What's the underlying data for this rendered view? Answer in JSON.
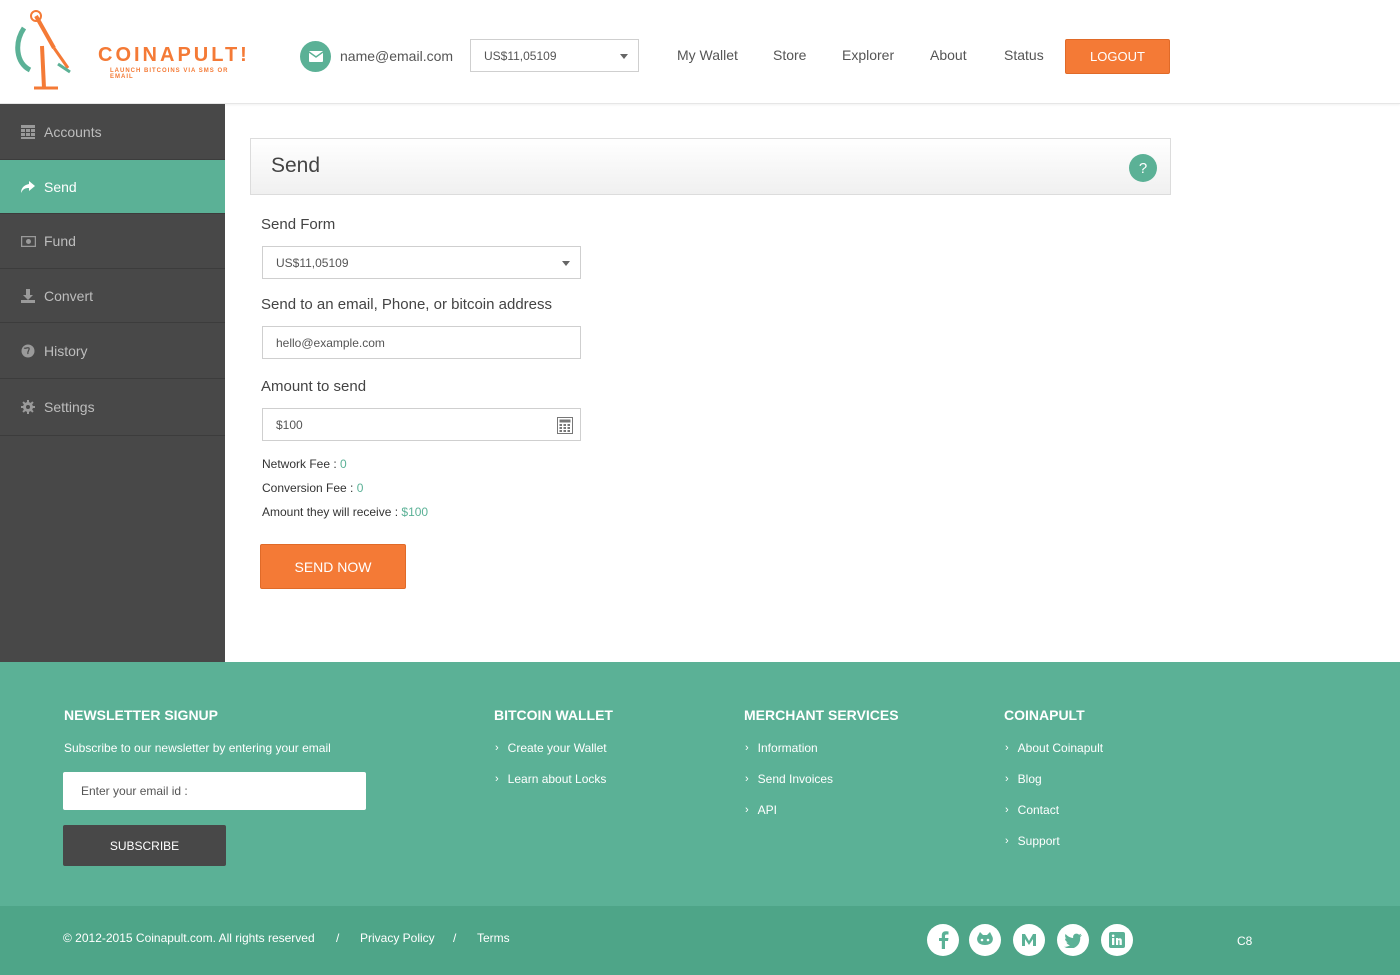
{
  "brand": {
    "name": "COINAPULT!",
    "tagline": "LAUNCH BITCOINS VIA SMS OR EMAIL",
    "orange": "#f47a36",
    "green": "#5bb196"
  },
  "header": {
    "email": "name@email.com",
    "balance_select": "US$11,05109",
    "nav": [
      "My Wallet",
      "Store",
      "Explorer",
      "About",
      "Status"
    ],
    "logout_label": "LOGOUT"
  },
  "sidebar": {
    "items": [
      {
        "label": "Accounts",
        "icon": "grid-icon"
      },
      {
        "label": "Send",
        "icon": "share-icon"
      },
      {
        "label": "Fund",
        "icon": "money-icon"
      },
      {
        "label": "Convert",
        "icon": "download-icon"
      },
      {
        "label": "History",
        "icon": "globe-icon"
      },
      {
        "label": "Settings",
        "icon": "gear-icon"
      }
    ],
    "active": "Send"
  },
  "main": {
    "title": "Send",
    "help_label": "?",
    "send_form_label": "Send Form",
    "send_form_value": "US$11,05109",
    "recipient_label": "Send to an email, Phone, or bitcoin address",
    "recipient_placeholder": "hello@example.com",
    "amount_label": "Amount to send",
    "amount_value": "$100",
    "network_fee_label": "Network Fee :",
    "network_fee_value": "0",
    "conversion_fee_label": "Conversion Fee :",
    "conversion_fee_value": "0",
    "receive_label": "Amount they will receive :",
    "receive_value": "$100",
    "send_button": "SEND NOW"
  },
  "footer": {
    "newsletter": {
      "title": "NEWSLETTER SIGNUP",
      "subtitle": "Subscribe to our newsletter by entering your email",
      "placeholder": "Enter your email id :",
      "button": "SUBSCRIBE"
    },
    "bitcoin_wallet": {
      "title": "BITCOIN WALLET",
      "links": [
        "Create your Wallet",
        "Learn about Locks"
      ]
    },
    "merchant_services": {
      "title": "MERCHANT SERVICES",
      "links": [
        "Information",
        "Send Invoices",
        "API"
      ]
    },
    "coinapult": {
      "title": "COINAPULT",
      "links": [
        "About Coinapult",
        "Blog",
        "Contact",
        "Support"
      ]
    },
    "copyright": "© 2012-2015 Coinapult.com. All rights reserved",
    "separator": "/",
    "privacy": "Privacy Policy",
    "terms": "Terms",
    "social": [
      "facebook-icon",
      "github-icon",
      "medium-icon",
      "twitter-icon",
      "linkedin-icon"
    ],
    "corner_text": "C8"
  }
}
